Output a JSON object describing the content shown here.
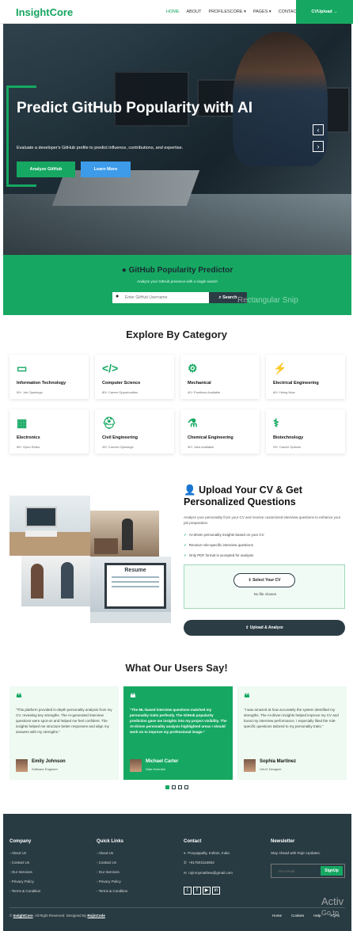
{
  "nav": {
    "logo": "InsightCore",
    "items": [
      "HOME",
      "ABOUT",
      "PROFILESCORE ▾",
      "PAGES ▾",
      "CONTACT"
    ],
    "cta": "CVUpload →"
  },
  "hero": {
    "title": "Predict GitHub Popularity with AI",
    "subtitle": "Evaluate a developer's GitHub profile to predict influence, contributions, and expertise.",
    "primary_button": "Analyze GitHub",
    "secondary_button": "Learn More",
    "prev_icon": "chevron-left-icon",
    "next_icon": "chevron-right-icon"
  },
  "predictor": {
    "title": "GitHub Popularity Predictor",
    "subtitle": "Analyze your GitHub presence with a single search",
    "placeholder": "Enter GitHub Username",
    "button": "Search",
    "overlay": "Rectangular Snip"
  },
  "categories": {
    "title": "Explore By Category",
    "items": [
      {
        "name": "Information Technology",
        "count": "50+ Job Openings",
        "icon": "▭"
      },
      {
        "name": "Computer Science",
        "count": "80+ Career Opportunities",
        "icon": "</>"
      },
      {
        "name": "Mechanical",
        "count": "40+ Positions Available",
        "icon": "⚙"
      },
      {
        "name": "Electrical Engineering",
        "count": "60+ Hiring Now",
        "icon": "⚡"
      },
      {
        "name": "Electronics",
        "count": "55+ Open Roles",
        "icon": "▦"
      },
      {
        "name": "Civil Engineering",
        "count": "45+ Current Openings",
        "icon": "⛑"
      },
      {
        "name": "Chemical Engineering",
        "count": "30+ Jobs Available",
        "icon": "⚗"
      },
      {
        "name": "Biotechnology",
        "count": "25+ Career Options",
        "icon": "⚕"
      }
    ]
  },
  "upload": {
    "title": "Upload Your CV & Get Personalized Questions",
    "description": "Analyze your personality from your CV and receive customized interview questions to enhance your job preparation.",
    "features": [
      "AI-driven personality insights based on your CV",
      "Receive role-specific interview questions",
      "Only PDF format is accepted for analysis"
    ],
    "select_button": "Select Your CV",
    "file_status": "No file chosen",
    "submit_button": "Upload & Analyze",
    "resume_label": "Resume"
  },
  "testimonials": {
    "title": "What Our Users Say!",
    "items": [
      {
        "text": "\"This platform provided in-depth personality analysis from my CV, revealing key strengths. The AI-generated interview questions were spot-on and helped me feel confident. The insights helped me structure better responses and align my answers with my strengths.\"",
        "name": "Emily Johnson",
        "role": "Software Engineer"
      },
      {
        "text": "\"The ML-based interview questions matched my personality traits perfectly. The GitHub popularity prediction gave me insights into my project visibility. The AI-driven personality analysis highlighted areas I should work on to improve my professional image.\"",
        "name": "Michael Carter",
        "role": "Data Scientist"
      },
      {
        "text": "\"I was amazed at how accurately the system identified my strengths. The AI-driven insights helped improve my CV and boost my interview performance. I especially liked the role-specific questions tailored to my personality traits.\"",
        "name": "Sophia Martinez",
        "role": "UI/UX Designer"
      }
    ]
  },
  "footer": {
    "company": {
      "title": "Company",
      "links": [
        "About Us",
        "Contact Us",
        "Our Services",
        "Privacy Policy",
        "Terms & Condition"
      ]
    },
    "quick": {
      "title": "Quick Links",
      "links": [
        "About Us",
        "Contact Us",
        "Our Services",
        "Privacy Policy",
        "Terms & Condition"
      ]
    },
    "contact": {
      "title": "Contact",
      "address": "Pooyappally, Kollam, India",
      "phone": "+917603116553",
      "email": "rojinroymathew@gmail.com"
    },
    "newsletter": {
      "title": "Newsletter",
      "text": "Stay Ahead with Rojin Updates.",
      "placeholder": "Your email",
      "button": "SignUp"
    },
    "copyright_prefix": "©",
    "brand": "InsightCore",
    "copyright_mid": ". All Right Reserved. Designed By",
    "designer": "RojinCode",
    "bottom_links": [
      "Home",
      "Cookies",
      "Help",
      "FQAs"
    ],
    "watermark1": "Activ",
    "watermark2": "Go to"
  },
  "colors": {
    "accent": "#16a862",
    "dark": "#283b42",
    "blue": "#3d9be9"
  }
}
